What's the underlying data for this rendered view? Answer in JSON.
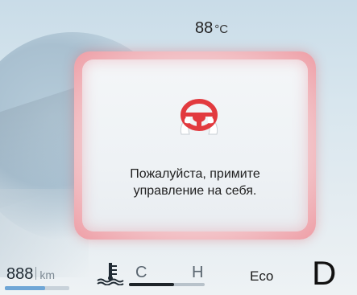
{
  "header": {
    "temperature_value": "88",
    "temperature_unit": "°C"
  },
  "alert": {
    "icon": "steering-wheel-hands-icon",
    "message_line1": "Пожалуйста, примите",
    "message_line2": "управление на себя.",
    "accent_color": "#e23a3f"
  },
  "status_bar": {
    "odometer_value": "888",
    "odometer_unit": "km",
    "odometer_level": 0.62,
    "coolant_icon": "coolant-temperature-icon",
    "gauge_cold_label": "C",
    "gauge_hot_label": "H",
    "coolant_level": 0.6,
    "drive_mode": "Eco",
    "gear": "D"
  }
}
